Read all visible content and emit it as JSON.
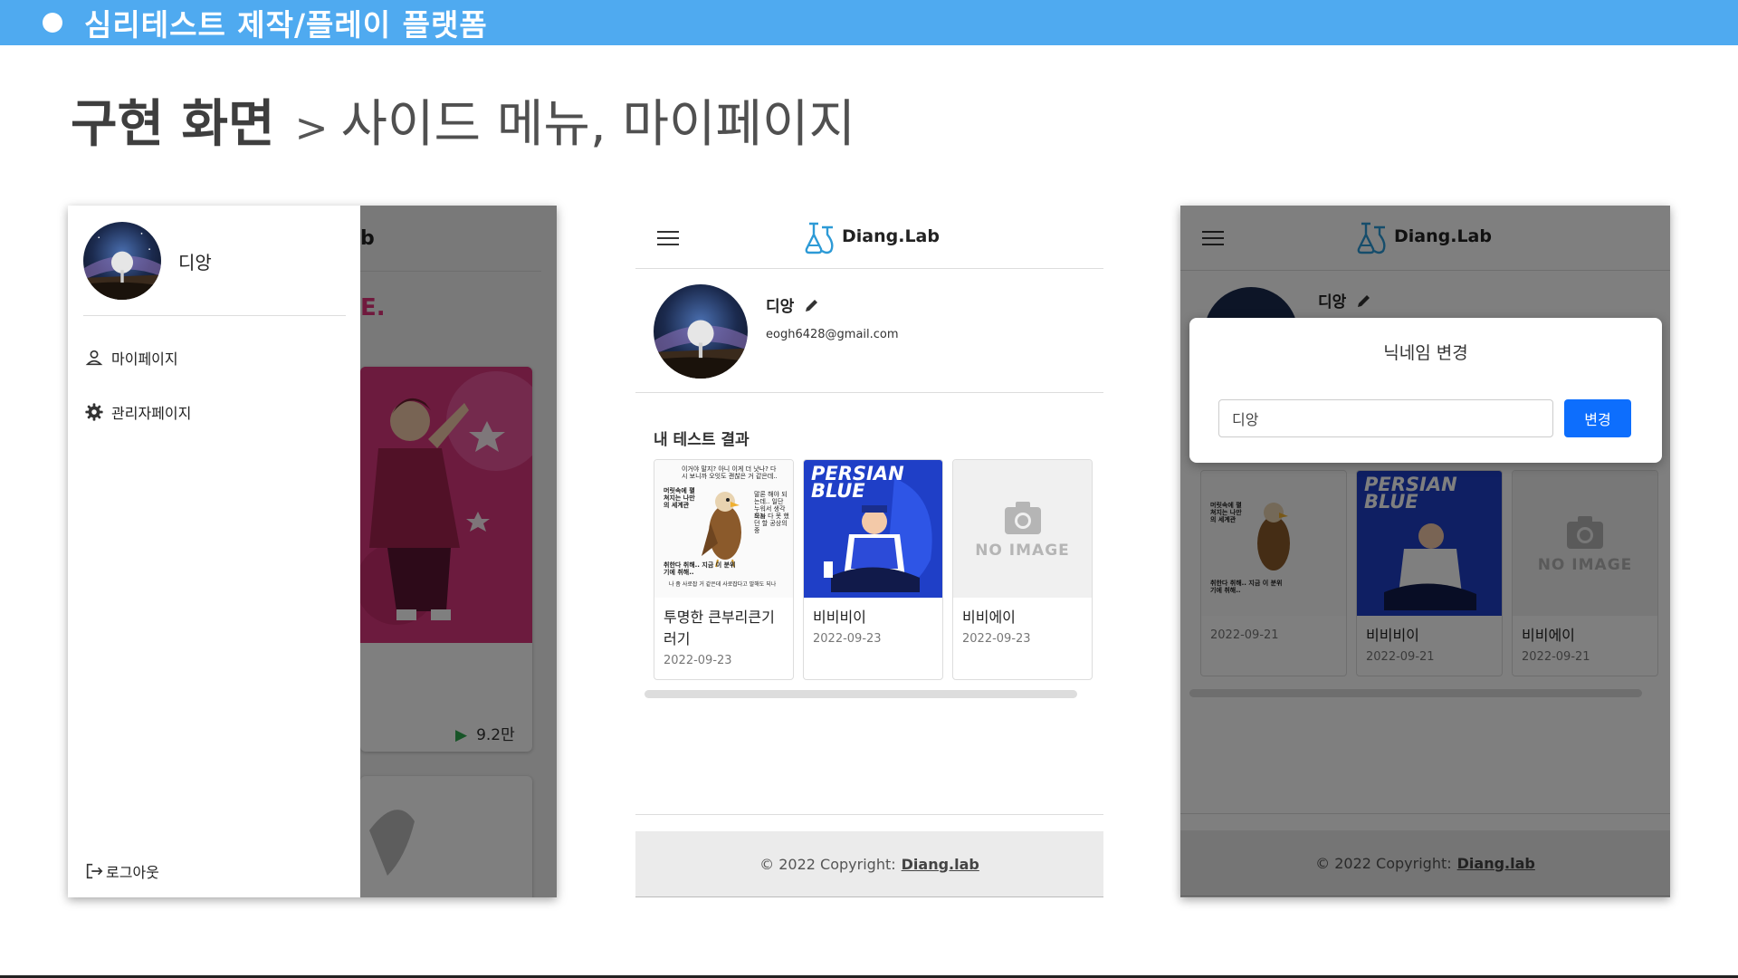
{
  "slide": {
    "header": "심리테스트 제작/플레이 플랫폼",
    "title_strong": "구현 화면",
    "title_arrow": ">",
    "title_sub": "사이드 메뉴, 마이페이지"
  },
  "side_menu": {
    "username": "디앙",
    "items": [
      {
        "label": "마이페이지",
        "icon": "person-icon"
      },
      {
        "label": "관리자페이지",
        "icon": "gear-icon"
      }
    ],
    "logout": "로그아웃",
    "background": {
      "logo_fragment": "b",
      "banner_fragment": "E.",
      "views": "9.2만"
    }
  },
  "mypage": {
    "brand": "Diang.Lab",
    "nickname": "디앙",
    "email": "eogh6428@gmail.com",
    "section_title": "내 테스트 결과",
    "cards": [
      {
        "title": "투명한 큰부리큰기러기",
        "date": "2022-09-23",
        "thumb": "eagle"
      },
      {
        "title": "비비비이",
        "date": "2022-09-23",
        "thumb": "persian"
      },
      {
        "title": "비비에이",
        "date": "2022-09-23",
        "thumb": "noimage"
      }
    ],
    "persian_text_1": "PERSIAN",
    "persian_text_2": "BLUE",
    "noimage_text": "NO IMAGE",
    "eagle_text": {
      "top": "이거야 말지? 아니 이게 더 낫나? 다시 보니까 오잇도 괜찮은 거 같은데..",
      "left": "머릿속에 펼쳐지는 나만의 세계관",
      "right": "말론 해야 되는데.. 일단 누워서 생각하자",
      "right2": "오늘 다 못 했던 할 공상의 중",
      "bottom": "취한다 취해.. 지금 이 분위기에 취해..",
      "footer": "나 좀 사로잡 거 같은데 사로잡다고 말해도 되나"
    },
    "footer": {
      "copyright": "© 2022 Copyright:",
      "link": "Diang.lab"
    }
  },
  "modal": {
    "title": "닉네임 변경",
    "input_value": "디앙",
    "button": "변경",
    "cards": [
      {
        "title": "",
        "date": "2022-09-21"
      },
      {
        "title": "비비비이",
        "date": "2022-09-21"
      },
      {
        "title": "비비에이",
        "date": "2022-09-21"
      }
    ]
  },
  "colors": {
    "header_bar": "#4faaf0",
    "primary_button": "#0d6efd",
    "banner_pink": "#d9367d"
  }
}
